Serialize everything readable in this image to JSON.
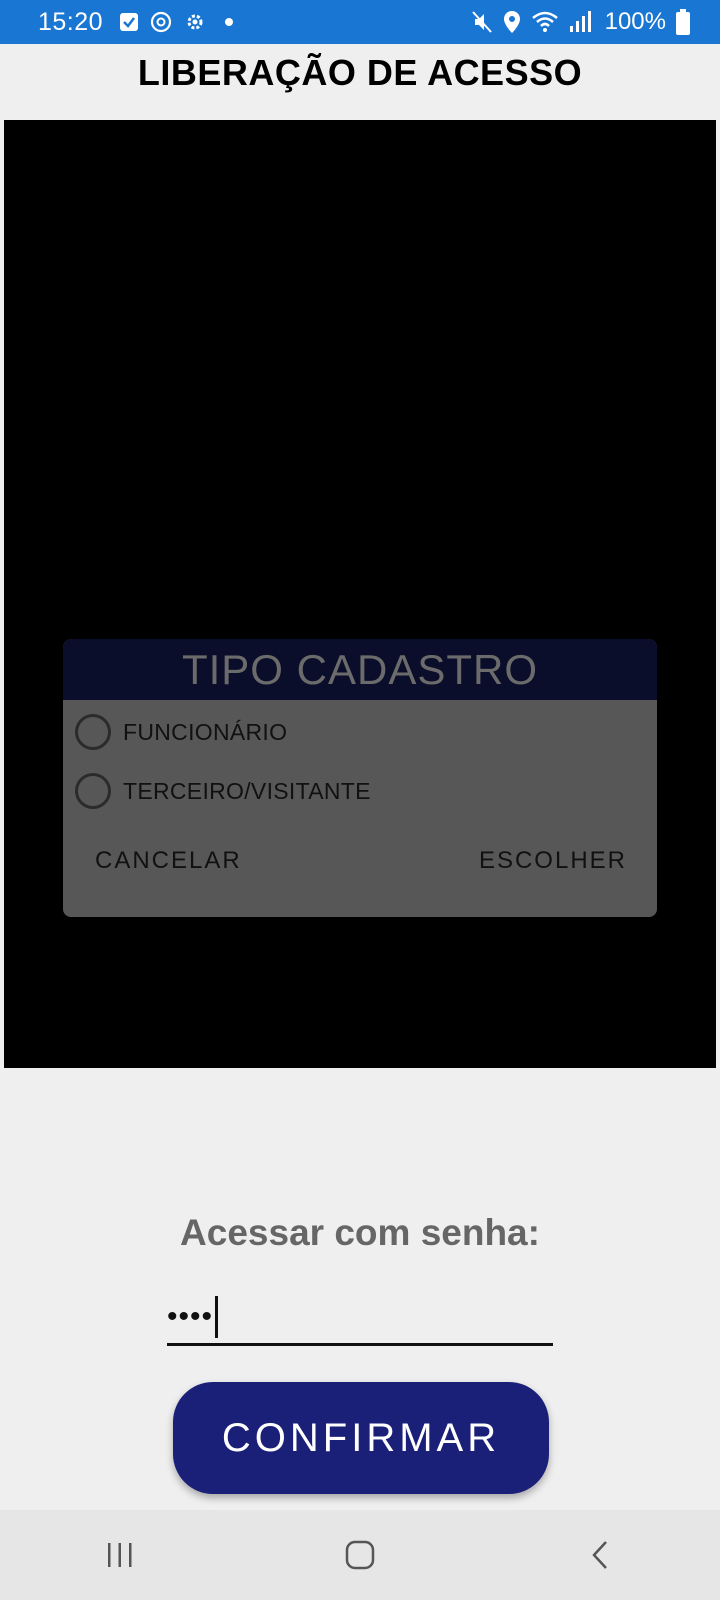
{
  "status_bar": {
    "time": "15:20",
    "battery": "100%",
    "left_icons": [
      "checkbox-icon",
      "sync-icon",
      "settings-icon",
      "dot-icon"
    ],
    "right_icons": [
      "mute-icon",
      "location-icon",
      "wifi-icon",
      "signal-icon",
      "battery-icon"
    ]
  },
  "header": {
    "title": "LIBERAÇÃO DE ACESSO"
  },
  "dialog": {
    "title": "TIPO CADASTRO",
    "options": [
      {
        "label": "FUNCIONÁRIO",
        "selected": false
      },
      {
        "label": "TERCEIRO/VISITANTE",
        "selected": false
      }
    ],
    "cancel_label": "CANCELAR",
    "choose_label": "ESCOLHER"
  },
  "password": {
    "label": "Acessar com senha:",
    "value": "••••"
  },
  "confirm_label": "CONFIRMAR",
  "nav_bar": {
    "buttons": [
      "recent-apps-icon",
      "home-icon",
      "back-icon"
    ]
  },
  "colors": {
    "status_bar": "#1976d2",
    "dialog_header": "#0b0e2a",
    "dialog_body": "#575757",
    "confirm_button": "#1a1f78"
  }
}
